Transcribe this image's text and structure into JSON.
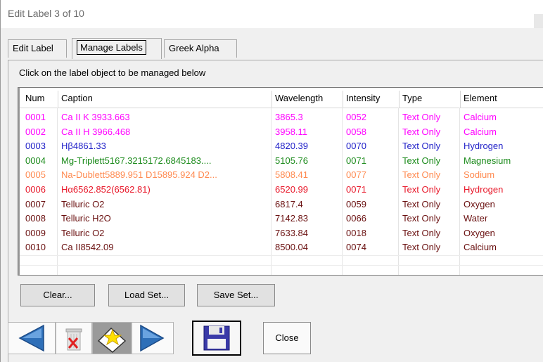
{
  "window": {
    "title": "Edit Label 3 of 10"
  },
  "tabs": [
    {
      "label": "Edit Label"
    },
    {
      "label": "Manage Labels"
    },
    {
      "label": "Greek Alpha"
    }
  ],
  "instruction": "Click on the label object to be managed below",
  "table": {
    "columns": [
      "Num",
      "Caption",
      "Wavelength",
      "Intensity",
      "Type",
      "Element"
    ],
    "rows": [
      {
        "num": "0001",
        "caption": "Ca II K 3933.663",
        "wavelength": "3865.3",
        "intensity": "0052",
        "type": "Text Only",
        "element": "Calcium",
        "color": "#ff00ff"
      },
      {
        "num": "0002",
        "caption": "Ca II H 3966.468",
        "wavelength": "3958.11",
        "intensity": "0058",
        "type": "Text Only",
        "element": "Calcium",
        "color": "#ff00ff"
      },
      {
        "num": "0003",
        "caption": "Hβ4861.33",
        "wavelength": "4820.39",
        "intensity": "0070",
        "type": "Text Only",
        "element": "Hydrogen",
        "color": "#1f1fc8"
      },
      {
        "num": "0004",
        "caption": "Mg-Triplett5167.3215172.6845183....",
        "wavelength": "5105.76",
        "intensity": "0071",
        "type": "Text Only",
        "element": "Magnesium",
        "color": "#1a8a1a"
      },
      {
        "num": "0005",
        "caption": "Na-Dublett5889.951 D15895.924 D2...",
        "wavelength": "5808.41",
        "intensity": "0077",
        "type": "Text Only",
        "element": "Sodium",
        "color": "#ff8a50"
      },
      {
        "num": "0006",
        "caption": "Hα6562.852(6562.81)",
        "wavelength": "6520.99",
        "intensity": "0071",
        "type": "Text Only",
        "element": "Hydrogen",
        "color": "#e8182a"
      },
      {
        "num": "0007",
        "caption": "Telluric O2",
        "wavelength": "6817.4",
        "intensity": "0059",
        "type": "Text Only",
        "element": "Oxygen",
        "color": "#6a1010"
      },
      {
        "num": "0008",
        "caption": "Telluric H2O",
        "wavelength": "7142.83",
        "intensity": "0066",
        "type": "Text Only",
        "element": "Water",
        "color": "#6a1010"
      },
      {
        "num": "0009",
        "caption": "Telluric O2",
        "wavelength": "7633.84",
        "intensity": "0018",
        "type": "Text Only",
        "element": "Oxygen",
        "color": "#6a1010"
      },
      {
        "num": "0010",
        "caption": "Ca II8542.09",
        "wavelength": "8500.04",
        "intensity": "0074",
        "type": "Text Only",
        "element": "Calcium",
        "color": "#6a1010"
      }
    ]
  },
  "buttons": {
    "clear": "Clear...",
    "load": "Load Set...",
    "save": "Save Set...",
    "close": "Close"
  },
  "icons": {
    "prev": "arrow-left-icon",
    "delete": "trash-icon",
    "new": "star-folder-icon",
    "next": "arrow-right-icon",
    "save": "floppy-disk-icon"
  },
  "colors": {
    "arrow": "#2e6fb8",
    "floppy": "#3a3aa8"
  }
}
